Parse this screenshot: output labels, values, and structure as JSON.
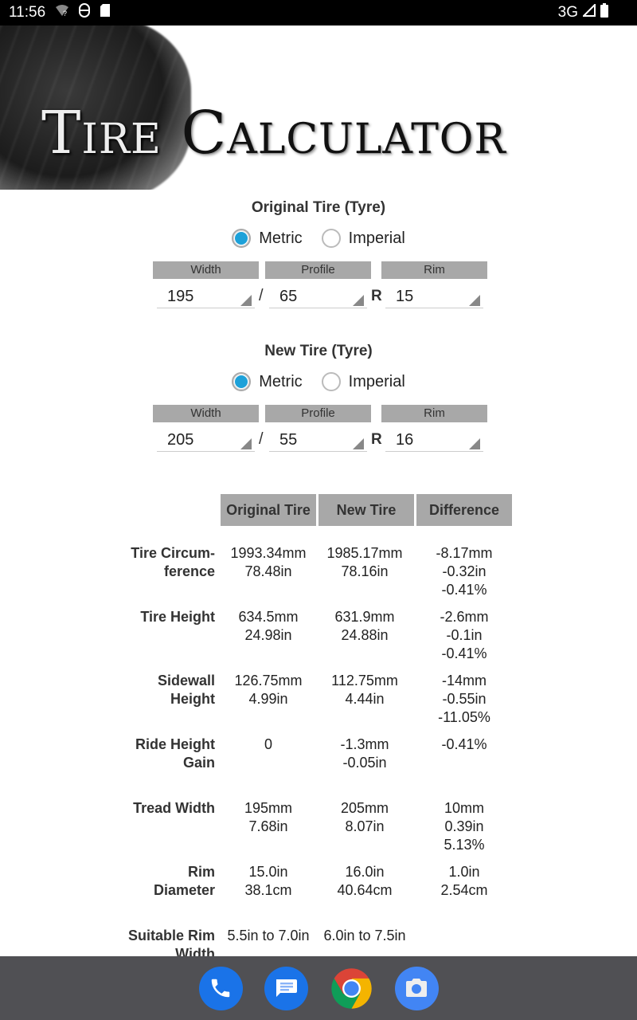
{
  "status_bar": {
    "time": "11:56",
    "network": "3G"
  },
  "banner": {
    "title_word1": "Tire",
    "title_word2": "Calculator"
  },
  "original": {
    "title": "Original Tire (Tyre)",
    "unit_options": [
      "Metric",
      "Imperial"
    ],
    "selected_unit": "Metric",
    "labels": {
      "width": "Width",
      "profile": "Profile",
      "rim": "Rim"
    },
    "width": "195",
    "profile": "65",
    "rim": "15"
  },
  "new": {
    "title": "New Tire (Tyre)",
    "unit_options": [
      "Metric",
      "Imperial"
    ],
    "selected_unit": "Metric",
    "labels": {
      "width": "Width",
      "profile": "Profile",
      "rim": "Rim"
    },
    "width": "205",
    "profile": "55",
    "rim": "16"
  },
  "separators": {
    "slash": "/",
    "r": "R"
  },
  "results": {
    "headers": [
      "Original Tire",
      "New Tire",
      "Difference"
    ],
    "rows": [
      {
        "label": [
          "Tire Circum-",
          "ference"
        ],
        "original": [
          "1993.34mm",
          "78.48in"
        ],
        "new": [
          "1985.17mm",
          "78.16in"
        ],
        "diff": [
          "-8.17mm",
          "-0.32in",
          "-0.41%"
        ]
      },
      {
        "label": [
          "Tire Height"
        ],
        "original": [
          "634.5mm",
          "24.98in"
        ],
        "new": [
          "631.9mm",
          "24.88in"
        ],
        "diff": [
          "-2.6mm",
          "-0.1in",
          "-0.41%"
        ]
      },
      {
        "label": [
          "Sidewall",
          "Height"
        ],
        "original": [
          "126.75mm",
          "4.99in"
        ],
        "new": [
          "112.75mm",
          "4.44in"
        ],
        "diff": [
          "-14mm",
          "-0.55in",
          "-11.05%"
        ]
      },
      {
        "label": [
          "Ride Height",
          "Gain"
        ],
        "original": [
          "0"
        ],
        "new": [
          "-1.3mm",
          "-0.05in"
        ],
        "diff": [
          "-0.41%"
        ]
      },
      {
        "label": [
          "Tread Width"
        ],
        "original": [
          "195mm",
          "7.68in"
        ],
        "new": [
          "205mm",
          "8.07in"
        ],
        "diff": [
          "10mm",
          "0.39in",
          "5.13%"
        ]
      },
      {
        "label": [
          "Rim",
          "Diameter"
        ],
        "original": [
          "15.0in",
          "38.1cm"
        ],
        "new": [
          "16.0in",
          "40.64cm"
        ],
        "diff": [
          "1.0in",
          "2.54cm"
        ]
      },
      {
        "label": [
          "Suitable Rim",
          "Width"
        ],
        "original": [
          "5.5in to 7.0in"
        ],
        "new": [
          "6.0in to 7.5in"
        ],
        "diff": []
      }
    ]
  },
  "dock": {
    "apps": [
      "Phone",
      "Messages",
      "Chrome",
      "Camera"
    ],
    "colors": {
      "phone": "#1a73e8",
      "messages": "#1a73e8",
      "camera": "#4285f4"
    }
  }
}
